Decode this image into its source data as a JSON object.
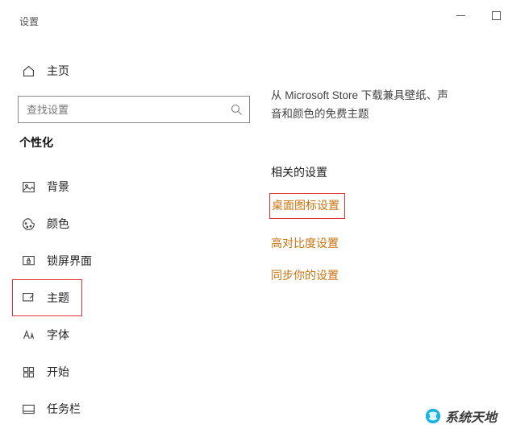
{
  "app": {
    "title": "设置"
  },
  "sidebar": {
    "home": "主页",
    "search_placeholder": "查找设置",
    "section": "个性化",
    "items": [
      {
        "label": "背景"
      },
      {
        "label": "颜色"
      },
      {
        "label": "锁屏界面"
      },
      {
        "label": "主题"
      },
      {
        "label": "字体"
      },
      {
        "label": "开始"
      },
      {
        "label": "任务栏"
      }
    ]
  },
  "content": {
    "store_line1": "从 Microsoft Store 下载兼具壁纸、声",
    "store_line2": "音和颜色的免费主题",
    "related_heading": "相关的设置",
    "links": [
      "桌面图标设置",
      "高对比度设置",
      "同步你的设置"
    ]
  },
  "watermark": {
    "text": "系统天地"
  }
}
